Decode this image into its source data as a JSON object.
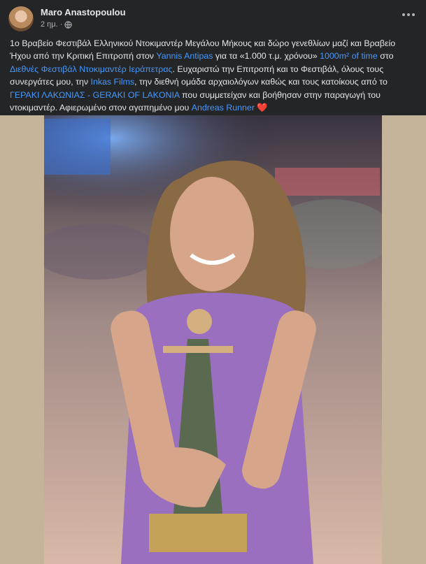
{
  "post": {
    "author": "Maro Anastopoulou",
    "time": "2 ημ.",
    "dot": "·",
    "privacy_icon": "globe-icon",
    "more_icon": "more-options-icon",
    "text": {
      "p1": "1ο Βραβείο Φεστιβάλ Ελληνικού Ντοκιμαντέρ Μεγάλου Μήκους και δώρο γενεθλίων μαζί και Βραβείο Ήχου από την Κριτική Επιτροπή στον ",
      "link1": "Yannis Antipas",
      "p2": " για τα «1.000 τ.μ. χρόνου» ",
      "link2": "1000m² of time",
      "p3": " στο ",
      "link3": "Διεθνές Φεστιβάλ Ντοκιμαντέρ Ιεράπετρας",
      "p4": ". Ευχαριστώ την Επιτροπή και το Φεστιβάλ, όλους τους συνεργάτες μου, την ",
      "link4": "Inkas Films",
      "p5": ", την διεθνή ομάδα αρχαιολόγων καθώς και τους κατοίκους από το ",
      "link5": "ΓΕΡΑΚΙ ΛΑΚΩΝΙΑΣ - GERAKI OF LAKONIA",
      "p6": " που συμμετείχαν και βοήθησαν στην παραγωγή του ντοκιμαντέρ. Αφιερωμένο στον αγαπημένο μου ",
      "link6": "Andreas Runner",
      "heart": " ❤️"
    }
  },
  "colors": {
    "background": "#242526",
    "link": "#4599ff",
    "text": "#e4e6eb",
    "meta": "#b0b3b8"
  }
}
